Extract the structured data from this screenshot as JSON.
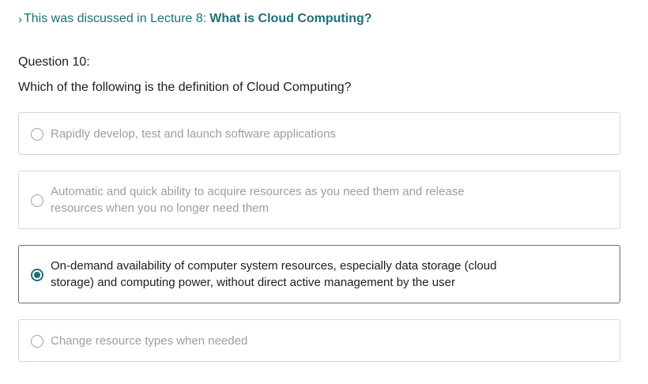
{
  "lecture_ref": {
    "prefix": "This was discussed in Lecture 8:",
    "title": "What is Cloud Computing?"
  },
  "question": {
    "number_label": "Question 10:",
    "text": "Which of the following is the definition of Cloud Computing?"
  },
  "options": [
    {
      "label": "Rapidly develop, test and launch software applications",
      "selected": false
    },
    {
      "label": "Automatic and quick ability to acquire resources as you need them and release resources when you no longer need them",
      "selected": false
    },
    {
      "label": "On-demand availability of computer system resources, especially data storage (cloud storage) and computing power, without direct active management by the user",
      "selected": true
    },
    {
      "label": "Change resource types when needed",
      "selected": false
    }
  ],
  "colors": {
    "accent": "#1e6f78",
    "muted_text": "#9a9fa3",
    "border": "#d1d7dc"
  }
}
